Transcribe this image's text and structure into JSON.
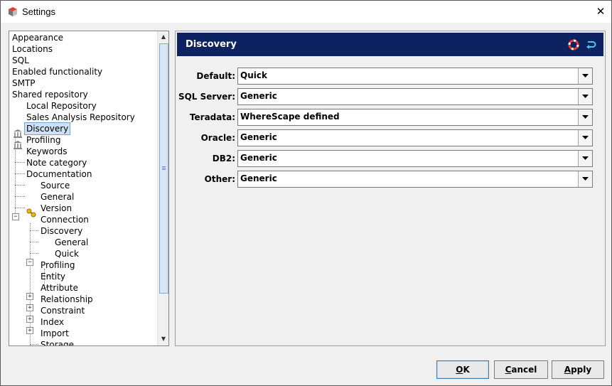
{
  "window": {
    "title": "Settings",
    "close_glyph": "✕"
  },
  "tree": {
    "items": [
      {
        "label": "Appearance"
      },
      {
        "label": "Locations"
      },
      {
        "label": "SQL"
      },
      {
        "label": "Enabled functionality"
      },
      {
        "label": "SMTP"
      },
      {
        "label": "Shared repository"
      },
      {
        "label": "Local Repository",
        "icon": "repository-icon"
      },
      {
        "label": "Sales Analysis Repository",
        "icon": "repository-icon"
      },
      {
        "label": "Discovery",
        "selected": true
      },
      {
        "label": "Profiling"
      },
      {
        "label": "Keywords"
      },
      {
        "label": "Note category"
      },
      {
        "label": "Documentation"
      },
      {
        "label": "Source",
        "icon": "source-icon",
        "expander": "minus"
      },
      {
        "label": "General"
      },
      {
        "label": "Version"
      },
      {
        "label": "Connection"
      },
      {
        "label": "Discovery",
        "expander": "minus"
      },
      {
        "label": "General"
      },
      {
        "label": "Quick"
      },
      {
        "label": "Profiling",
        "expander": "plus"
      },
      {
        "label": "Entity",
        "expander": "plus"
      },
      {
        "label": "Attribute",
        "expander": "plus"
      },
      {
        "label": "Relationship",
        "expander": "plus"
      },
      {
        "label": "Constraint"
      },
      {
        "label": "Index"
      },
      {
        "label": "Import"
      },
      {
        "label": "Storage"
      }
    ]
  },
  "panel": {
    "title": "Discovery",
    "header_icons": [
      "help-lifebuoy-icon",
      "reset-arrow-icon"
    ],
    "fields": [
      {
        "label": "Default:",
        "value": "Quick"
      },
      {
        "label": "SQL Server:",
        "value": "Generic"
      },
      {
        "label": "Teradata:",
        "value": "WhereScape defined"
      },
      {
        "label": "Oracle:",
        "value": "Generic"
      },
      {
        "label": "DB2:",
        "value": "Generic"
      },
      {
        "label": "Other:",
        "value": "Generic"
      }
    ]
  },
  "buttons": {
    "ok": {
      "mnemonic": "O",
      "rest": "K"
    },
    "cancel": {
      "mnemonic": "C",
      "rest": "ancel"
    },
    "apply": {
      "mnemonic": "A",
      "rest": "pply"
    }
  },
  "colors": {
    "header_bg": "#0d2260",
    "selection_bg": "#cde1f6",
    "help_icon": "#d32f2f",
    "reset_icon": "#4fc3f7"
  }
}
